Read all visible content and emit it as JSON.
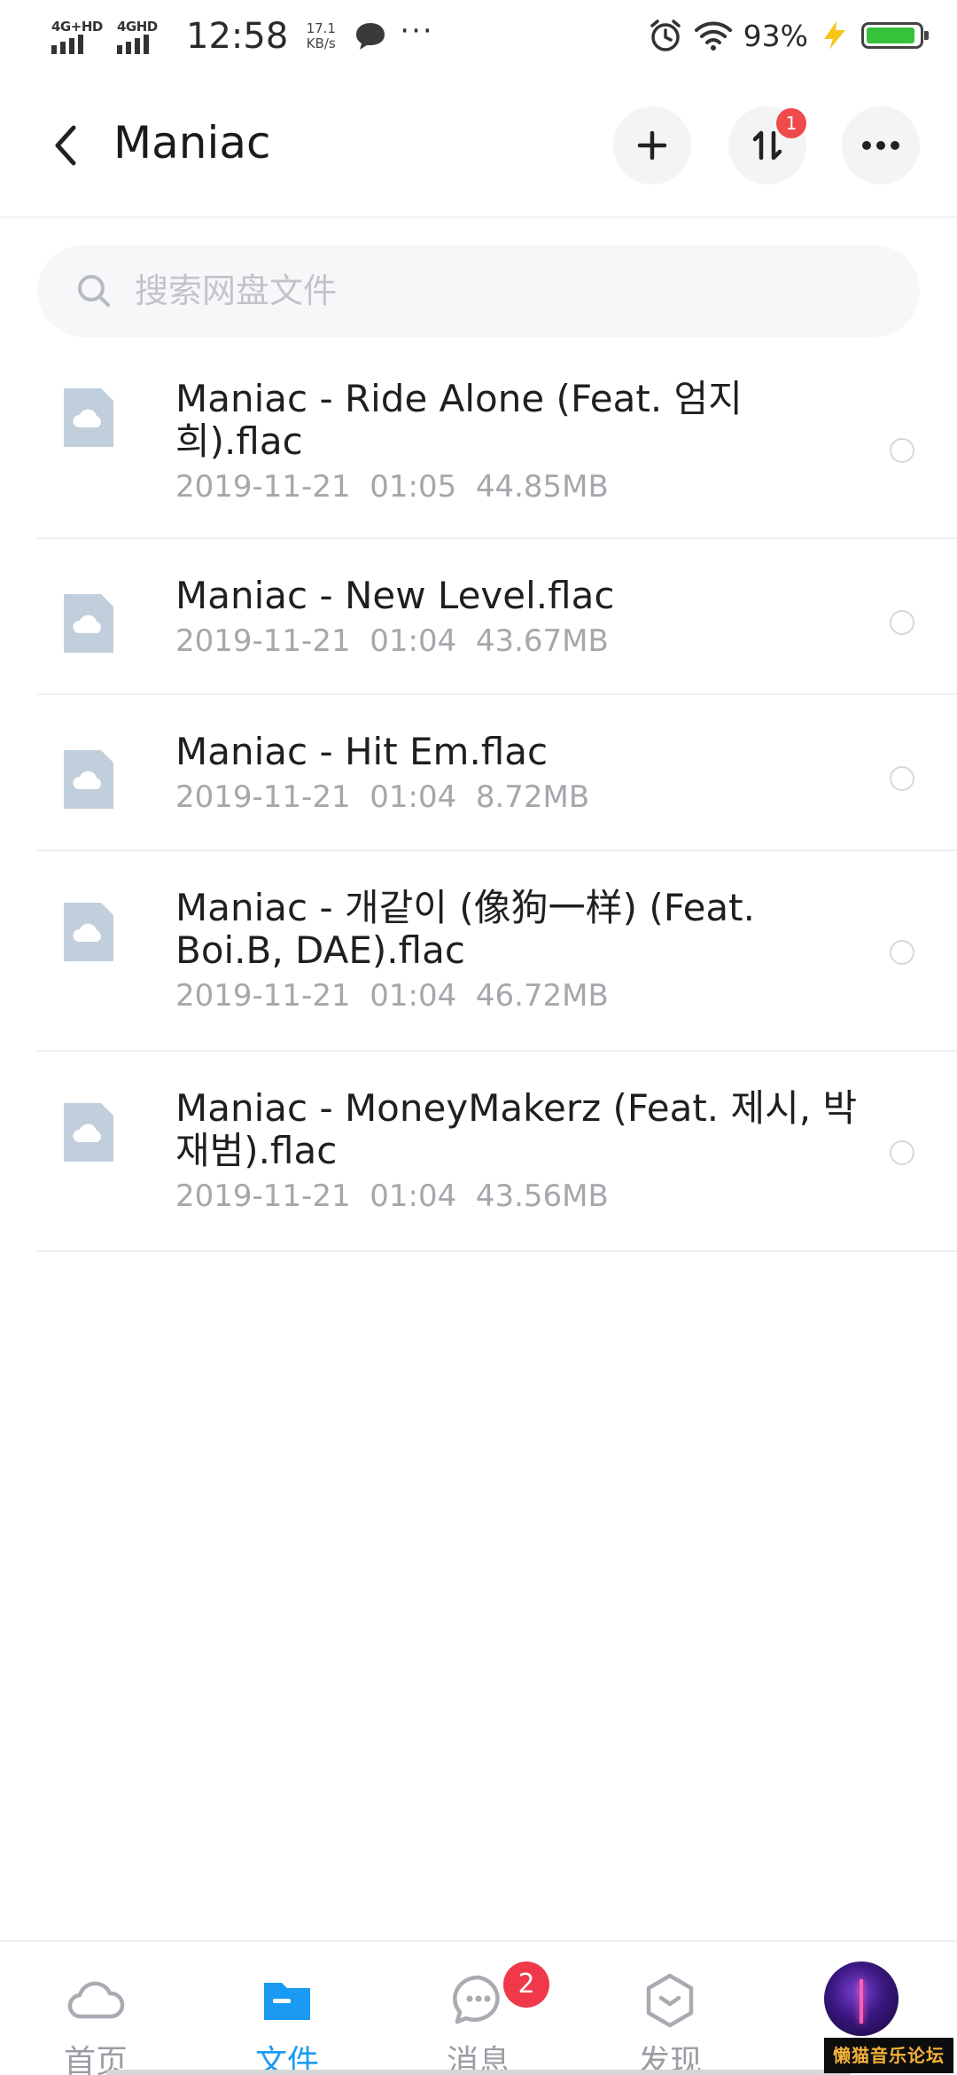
{
  "status_bar": {
    "network_1": "4G+HD",
    "network_2": "4GHD",
    "time": "12:58",
    "speed_value": "17.1",
    "speed_unit": "KB/s",
    "more": "···",
    "battery": "93%"
  },
  "header": {
    "title": "Maniac",
    "transfer_badge": "1",
    "icons": {
      "back": "chevron-left-icon",
      "add": "plus-icon",
      "transfer": "transfer-arrows-icon",
      "more": "more-horizontal-icon"
    }
  },
  "search": {
    "placeholder": "搜索网盘文件",
    "value": ""
  },
  "files": [
    {
      "name": "Maniac - Ride Alone (Feat. 엄지희).flac",
      "date": "2019-11-21",
      "time": "01:05",
      "size": "44.85MB"
    },
    {
      "name": "Maniac - New Level.flac",
      "date": "2019-11-21",
      "time": "01:04",
      "size": "43.67MB"
    },
    {
      "name": "Maniac - Hit Em.flac",
      "date": "2019-11-21",
      "time": "01:04",
      "size": "8.72MB"
    },
    {
      "name": "Maniac - 개같이 (像狗一样) (Feat. Boi.B, DAE).flac",
      "date": "2019-11-21",
      "time": "01:04",
      "size": "46.72MB"
    },
    {
      "name": "Maniac - MoneyMakerz (Feat. 제시, 박재범).flac",
      "date": "2019-11-21",
      "time": "01:04",
      "size": "43.56MB"
    }
  ],
  "bottom_nav": {
    "items": [
      {
        "label": "首页",
        "icon": "cloud-icon"
      },
      {
        "label": "文件",
        "icon": "folder-icon",
        "active": true
      },
      {
        "label": "消息",
        "icon": "chat-bubble-icon",
        "badge": "2"
      },
      {
        "label": "发现",
        "icon": "discover-hexagon-icon"
      }
    ],
    "watermark": "懒猫音乐论坛"
  },
  "colors": {
    "accent": "#1a9af2",
    "badge": "#f04a4a",
    "battery": "#36c23a",
    "file_icon": "#c1cfdc"
  }
}
